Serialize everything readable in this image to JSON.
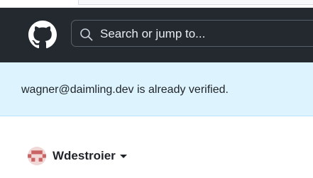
{
  "header": {
    "logo_icon": "github-octocat-icon",
    "search_icon": "search-icon",
    "search_placeholder": "Search or jump to..."
  },
  "flash": {
    "message": "wagner@daimling.dev is already verified."
  },
  "user": {
    "avatar_icon": "avatar",
    "name": "Wdestroier",
    "menu_icon": "caret-down-icon"
  },
  "colors": {
    "header_bg": "#24292f",
    "flash_bg": "#ddf4ff",
    "text": "#1f2328",
    "avatar_bg": "#f2d7d7",
    "avatar_fg": "#c86464"
  }
}
